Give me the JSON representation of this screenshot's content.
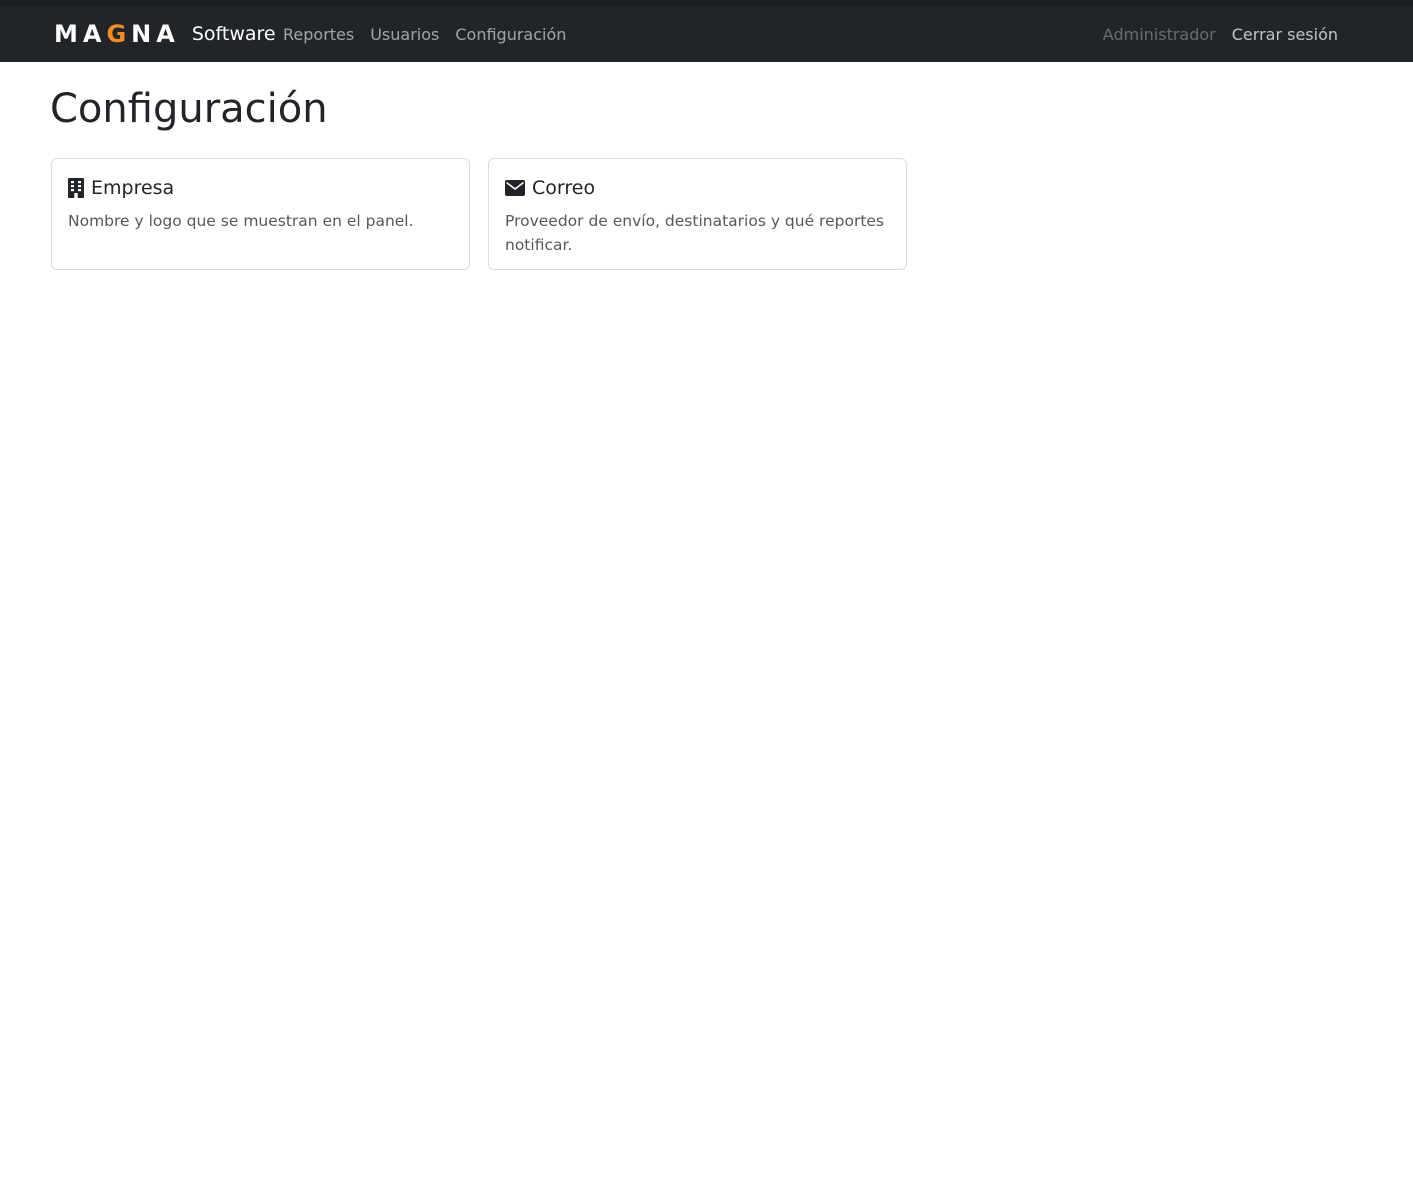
{
  "brand": {
    "logo_letters": [
      "M",
      "A",
      "G",
      "N",
      "A"
    ],
    "logo_text": "MAGNA",
    "name": "Software",
    "accent_color": "#f28c1e"
  },
  "nav": {
    "items": [
      {
        "label": "Reportes"
      },
      {
        "label": "Usuarios"
      },
      {
        "label": "Configuración"
      }
    ],
    "user_label": "Administrador",
    "logout_label": "Cerrar sesión"
  },
  "page": {
    "title": "Configuración"
  },
  "cards": [
    {
      "icon": "building-icon",
      "title": "Empresa",
      "description": "Nombre y logo que se muestran en el panel."
    },
    {
      "icon": "envelope-icon",
      "title": "Correo",
      "description": "Proveedor de envío, destinatarios y qué reportes notificar."
    }
  ],
  "colors": {
    "navbar_bg": "#212529",
    "page_bg": "#ffffff",
    "card_border": "#d9dcdf"
  }
}
